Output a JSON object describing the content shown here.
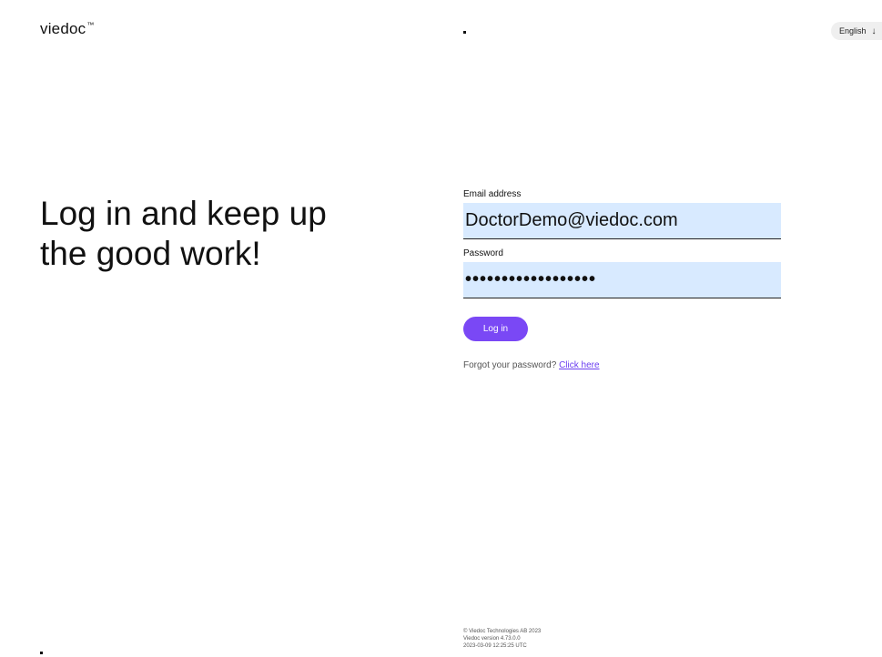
{
  "header": {
    "logo_text": "viedoc",
    "logo_mark": "™",
    "language_label": "English",
    "language_arrow": "↓"
  },
  "hero": {
    "headline_line1": "Log in and keep up",
    "headline_line2": "the good work!"
  },
  "form": {
    "email_label": "Email address",
    "email_value": "DoctorDemo@viedoc.com",
    "password_label": "Password",
    "password_value": "••••••••••••••••••",
    "login_label": "Log in",
    "forgot_text": "Forgot your password?",
    "forgot_link": "Click here"
  },
  "footer": {
    "copyright": "© Viedoc Technologies AB 2023",
    "version": "Viedoc version 4.73.0.0",
    "timestamp": "2023-03-09 12:25:25 UTC"
  },
  "colors": {
    "accent": "#7a48f5",
    "input_bg": "#d8eaff",
    "link": "#6a3df0"
  }
}
